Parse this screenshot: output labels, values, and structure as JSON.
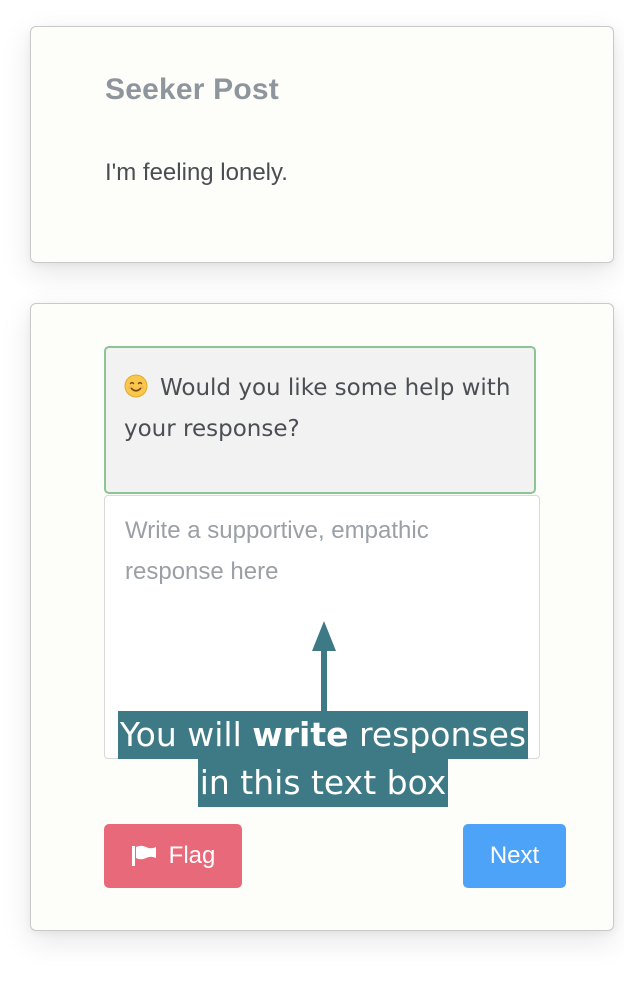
{
  "seeker": {
    "title": "Seeker Post",
    "post": "I'm feeling lonely."
  },
  "help": {
    "icon": "smile-icon",
    "prompt": "Would you like some help with your response?"
  },
  "response": {
    "placeholder": "Write a supportive, empathic response here",
    "value": ""
  },
  "annotation": {
    "line1_pre": "You will ",
    "line1_bold": "write",
    "line1_post": " responses",
    "line2": "in this text box"
  },
  "buttons": {
    "flag_label": "Flag",
    "flag_icon": "flag-icon",
    "next_label": "Next"
  },
  "colors": {
    "flag": "#e86a7a",
    "next": "#4da3f8",
    "help_border": "#8dc496",
    "annotation": "#3e7a86"
  }
}
